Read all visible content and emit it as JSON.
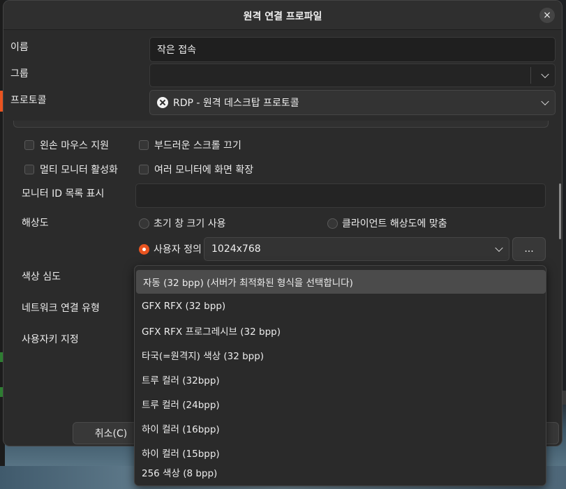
{
  "dialog": {
    "title": "원격 연결 프로파일",
    "close": "×"
  },
  "form": {
    "name_label": "이름",
    "name_value": "작은 접속",
    "group_label": "그룹",
    "group_value": "",
    "protocol_label": "프로토콜",
    "protocol_value": "RDP - 원격 데스크탑 프로토콜"
  },
  "options": {
    "left_mouse_support": "왼손 마우스 지원",
    "disable_smooth_scroll": "부드러운 스크롤 끄기",
    "enable_multimonitor": "멀티 모니터 활성화",
    "span_screen": "여러 모니터에 화면 확장",
    "monitor_id_label": "모니터 ID 목록 표시",
    "monitor_id_value": "",
    "resolution_label": "해상도",
    "res_initial": "초기 창 크기 사용",
    "res_client": "클라이언트 해상도에 맞춤",
    "res_custom": "사용자 정의",
    "res_custom_value": "1024x768",
    "res_more": "...",
    "color_depth_label": "색상 심도",
    "network_type_label": "네트워크 연결 유형",
    "keyboard_label": "사용자키 지정"
  },
  "color_depth_menu": [
    "자동 (32 bpp) (서버가 최적화된 형식을 선택합니다)",
    "GFX RFX (32 bpp)",
    "GFX RFX 프로그레시브 (32 bpp)",
    "타국(=원격지) 색상 (32 bpp)",
    "트루 컬러 (32bpp)",
    "트루 컬러 (24bpp)",
    "하이 컬러 (16bpp)",
    "하이 컬러 (15bpp)",
    "256 색상 (8 bpp)"
  ],
  "footer": {
    "cancel": "취소(C)"
  },
  "colors": {
    "accent": "#e95420",
    "dialog_bg": "#2b2b2b"
  }
}
